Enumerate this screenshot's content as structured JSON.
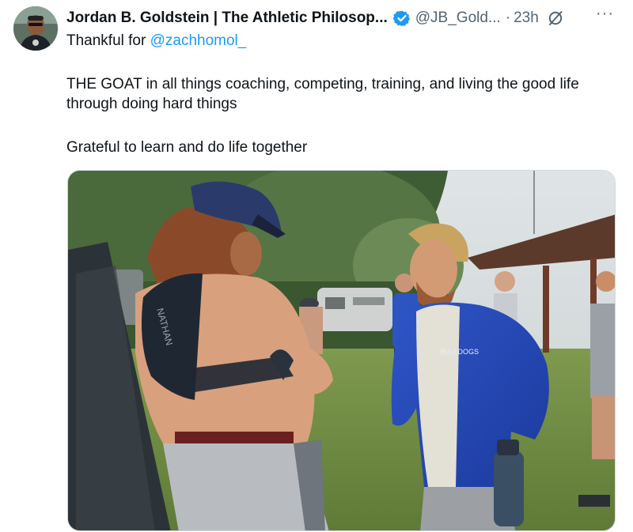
{
  "post": {
    "author_name": "Jordan B. Goldstein | The Athletic Philosop...",
    "handle": "@JB_Gold...",
    "separator": "·",
    "timestamp": "23h",
    "more_label": "···",
    "intro_prefix": "Thankful for ",
    "mention": "@zachhomol_",
    "paragraph_1": "THE GOAT in all things coaching, competing, training, and living the good life through doing hard things",
    "paragraph_2": "Grateful to learn and do life together"
  },
  "colors": {
    "link": "#1d9bf0",
    "verified_badge": "#1d9bf0",
    "secondary_text": "#536471"
  },
  "icons": {
    "verified": "verified-badge-icon",
    "grok": "grok-icon",
    "more": "more-options-icon"
  },
  "photo": {
    "jacket_text": "BULLDOGS",
    "vest_text": "NATHAN"
  }
}
